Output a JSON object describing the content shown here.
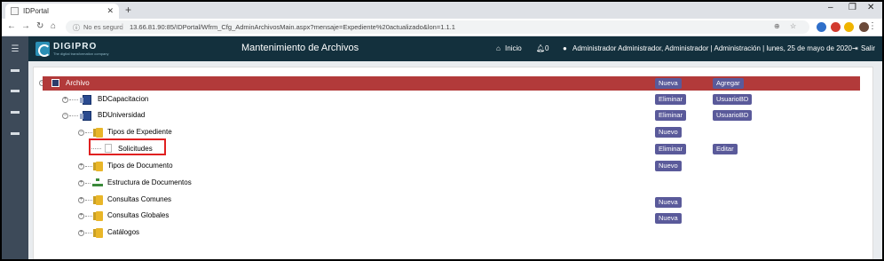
{
  "browser": {
    "tab_title": "IDPortal",
    "security_label": "No es seguro",
    "url": "13.66.81.90:85/IDPortal/Wfrm_Cfg_AdminArchivosMain.aspx?mensaje=Expediente%20actualizado&lon=1.1.1"
  },
  "header": {
    "logo_name": "DIGIPRO",
    "logo_tagline": "The digital transformation company",
    "title": "Mantenimiento de Archivos",
    "inicio": "Inicio",
    "notifications_count": "0",
    "user_info": "Administrador Administrador, Administrador | Administración | lunes, 25 de mayo de 2020",
    "logout": "Salir"
  },
  "tree": {
    "root": {
      "label": "Archivo",
      "btn1": "Nueva",
      "btn2": "Agregar"
    },
    "items": [
      {
        "label": "BDCapacitacion",
        "btn1": "Eliminar",
        "btn2": "UsuarioBD"
      },
      {
        "label": "BDUniversidad",
        "btn1": "Eliminar",
        "btn2": "UsuarioBD"
      },
      {
        "label": "Tipos de Expediente",
        "btn1": "Nuevo"
      },
      {
        "label": "Solicitudes",
        "btn1": "Eliminar",
        "btn2": "Editar"
      },
      {
        "label": "Tipos de Documento",
        "btn1": "Nuevo"
      },
      {
        "label": "Estructura de Documentos"
      },
      {
        "label": "Consultas Comunes",
        "btn1": "Nueva"
      },
      {
        "label": "Consultas Globales",
        "btn1": "Nueva"
      },
      {
        "label": "Catálogos"
      }
    ]
  }
}
